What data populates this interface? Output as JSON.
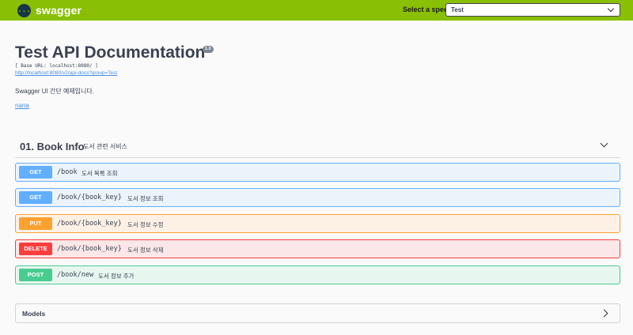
{
  "topbar": {
    "brand": "swagger",
    "logo_icon": "swagger-braces-logo",
    "logo_glyph": "{...}",
    "select_label": "Select a spec",
    "selected_spec": "Test",
    "background": "#89bf04"
  },
  "info": {
    "title": "Test API Documentation",
    "version": "1.0",
    "base_url": "[ Base URL: localhost:8080/ ]",
    "docs_link": "http://localhost:8080/v2/api-docs?group=Test",
    "description": "Swagger UI 간단 예제입니다.",
    "contact": "nana"
  },
  "tag": {
    "name": "01. Book Info",
    "description": "도서 관련 서비스",
    "expanded": true
  },
  "operations": [
    {
      "method": "GET",
      "path": "/book",
      "summary": "도서 목록 조회",
      "color": "#61affe"
    },
    {
      "method": "GET",
      "path": "/book/{book_key}",
      "summary": "도서 정보 조회",
      "color": "#61affe"
    },
    {
      "method": "PUT",
      "path": "/book/{book_key}",
      "summary": "도서 정보 수정",
      "color": "#fca130"
    },
    {
      "method": "DELETE",
      "path": "/book/{book_key}",
      "summary": "도서 정보 삭제",
      "color": "#f93e3e"
    },
    {
      "method": "POST",
      "path": "/book/new",
      "summary": "도서 정보 추가",
      "color": "#49cc90"
    }
  ],
  "models": {
    "label": "Models",
    "expanded": false
  }
}
